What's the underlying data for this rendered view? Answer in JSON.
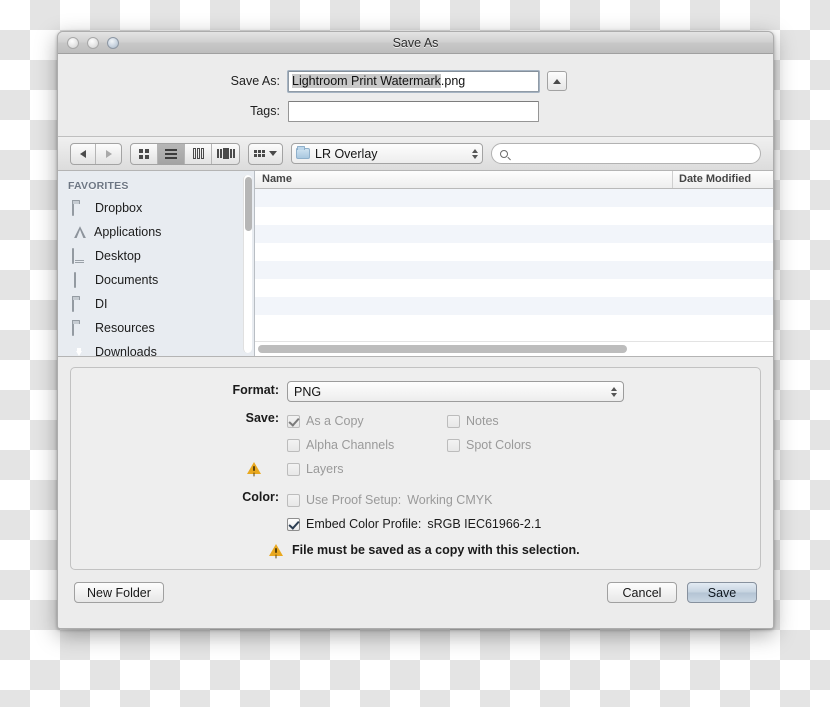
{
  "window": {
    "title": "Save As",
    "traffic_lights": [
      "close-button",
      "minimize-button",
      "zoom-button"
    ]
  },
  "name_area": {
    "save_as_label": "Save As:",
    "filename_selected": "Lightroom Print Watermark",
    "filename_extension": ".png",
    "filename_full": "Lightroom Print Watermark.png",
    "tags_label": "Tags:",
    "tags_value": "",
    "tags_placeholder": "",
    "disclosure_icon": "triangle-up-icon"
  },
  "toolbar": {
    "back_icon": "chevron-left-icon",
    "forward_icon": "chevron-right-icon",
    "view_modes": [
      {
        "name": "icon-view",
        "icon": "grid-icon",
        "selected": false
      },
      {
        "name": "list-view",
        "icon": "list-icon",
        "selected": true
      },
      {
        "name": "column-view",
        "icon": "columns-icon",
        "selected": false
      },
      {
        "name": "coverflow-view",
        "icon": "coverflow-icon",
        "selected": false
      }
    ],
    "arrange_icon": "arrange-grid-icon",
    "arrange_chevron": "chevron-down-icon",
    "path_label": "LR Overlay",
    "path_folder_icon": "folder-icon",
    "search_placeholder": "",
    "search_value": "",
    "search_icon": "search-icon"
  },
  "sidebar": {
    "header": "FAVORITES",
    "items": [
      {
        "label": "Dropbox",
        "icon": "folder-icon"
      },
      {
        "label": "Applications",
        "icon": "applications-icon"
      },
      {
        "label": "Desktop",
        "icon": "desktop-icon"
      },
      {
        "label": "Documents",
        "icon": "documents-icon"
      },
      {
        "label": "DI",
        "icon": "folder-icon"
      },
      {
        "label": "Resources",
        "icon": "folder-icon"
      },
      {
        "label": "Downloads",
        "icon": "downloads-icon"
      }
    ]
  },
  "filelist": {
    "columns": [
      "Name",
      "Date Modified"
    ],
    "rows": []
  },
  "options": {
    "format_label": "Format:",
    "format_value": "PNG",
    "save_label": "Save:",
    "checkboxes": [
      {
        "label": "As a Copy",
        "checked": true,
        "enabled": false
      },
      {
        "label": "Notes",
        "checked": false,
        "enabled": false
      },
      {
        "label": "Alpha Channels",
        "checked": false,
        "enabled": false
      },
      {
        "label": "Spot Colors",
        "checked": false,
        "enabled": false
      },
      {
        "label": "Layers",
        "checked": false,
        "enabled": false
      }
    ],
    "layers_warning_icon": "warning-triangle-icon",
    "color_label": "Color:",
    "proof_label": "Use Proof Setup:",
    "proof_value": "Working CMYK",
    "proof_checked": false,
    "proof_enabled": false,
    "embed_label": "Embed Color Profile:",
    "embed_value": "sRGB IEC61966-2.1",
    "embed_checked": true,
    "warning_icon": "warning-triangle-icon",
    "warning_message": "File must be saved as a copy with this selection."
  },
  "buttons": {
    "new_folder": "New Folder",
    "cancel": "Cancel",
    "save": "Save"
  },
  "colors": {
    "warning_amber": "#e9a81f",
    "default_button_blue": "#c6d3e0",
    "sidebar_background": "#e8ecf1",
    "selection_gray": "#c8c8c8"
  }
}
